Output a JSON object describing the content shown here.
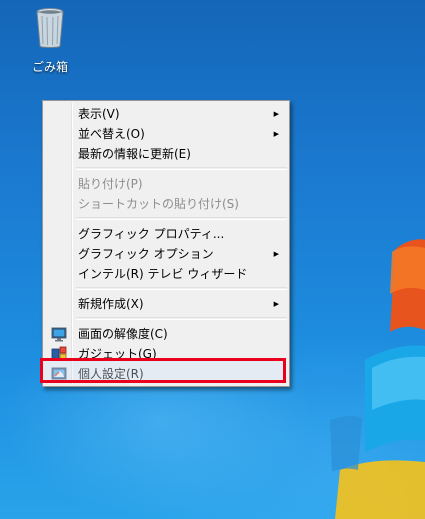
{
  "desktop": {
    "recycle_bin_label": "ごみ箱"
  },
  "context_menu": {
    "group1": [
      {
        "label": "表示(V)",
        "submenu": true
      },
      {
        "label": "並べ替え(O)",
        "submenu": true
      },
      {
        "label": "最新の情報に更新(E)",
        "submenu": false
      }
    ],
    "group2": [
      {
        "label": "貼り付け(P)",
        "disabled": true
      },
      {
        "label": "ショートカットの貼り付け(S)",
        "disabled": true
      }
    ],
    "group3": [
      {
        "label": "グラフィック プロパティ...",
        "submenu": false
      },
      {
        "label": "グラフィック オプション",
        "submenu": true
      },
      {
        "label": "インテル(R) テレビ ウィザード",
        "submenu": false
      }
    ],
    "group4": [
      {
        "label": "新規作成(X)",
        "submenu": true
      }
    ],
    "group5": [
      {
        "label": "画面の解像度(C)",
        "icon": "display-resolution-icon"
      },
      {
        "label": "ガジェット(G)",
        "icon": "gadgets-icon"
      },
      {
        "label": "個人設定(R)",
        "icon": "personalize-icon",
        "highlighted": true
      }
    ]
  },
  "colors": {
    "highlight_border": "#e8001c",
    "desktop_blue": "#1b7bd1"
  }
}
